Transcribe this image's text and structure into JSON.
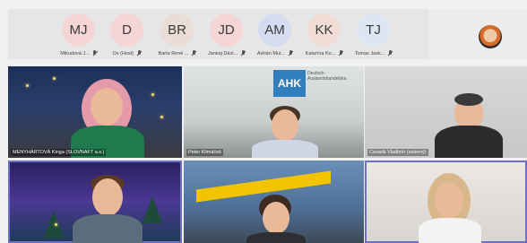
{
  "participants": [
    {
      "initials": "MJ",
      "name": "Mikudová J...",
      "color": "#f5d5d5",
      "muted": true
    },
    {
      "initials": "D",
      "name": "Ds (Host)",
      "color": "#f5d5d5",
      "muted": true
    },
    {
      "initials": "BR",
      "name": "Barta René ...",
      "color": "#e9ddd5",
      "muted": true
    },
    {
      "initials": "JD",
      "name": "Jankaj Dávi...",
      "color": "#f5d5d5",
      "muted": true
    },
    {
      "initials": "AM",
      "name": "Adrián Mur...",
      "color": "#d6dcef",
      "muted": true
    },
    {
      "initials": "KK",
      "name": "Katarína Ko...",
      "color": "#f0ddd5",
      "muted": true
    },
    {
      "initials": "TJ",
      "name": "Tomas Jask...",
      "color": "#dde6f2",
      "muted": true
    }
  ],
  "video_tiles": [
    {
      "label": "MENYHÁRTOVÁ Kinga (SLOVNAFT a.s.)",
      "active": false
    },
    {
      "label": "Peter Klimáček",
      "active": false
    },
    {
      "label": "Cesarik Vladimír (externý)",
      "active": false
    },
    {
      "label": "",
      "active": true
    },
    {
      "label": "",
      "active": false
    },
    {
      "label": "",
      "active": true
    }
  ],
  "tile2": {
    "logo": "AHK",
    "side_text": "Deutsch- Auslandshandelska"
  }
}
